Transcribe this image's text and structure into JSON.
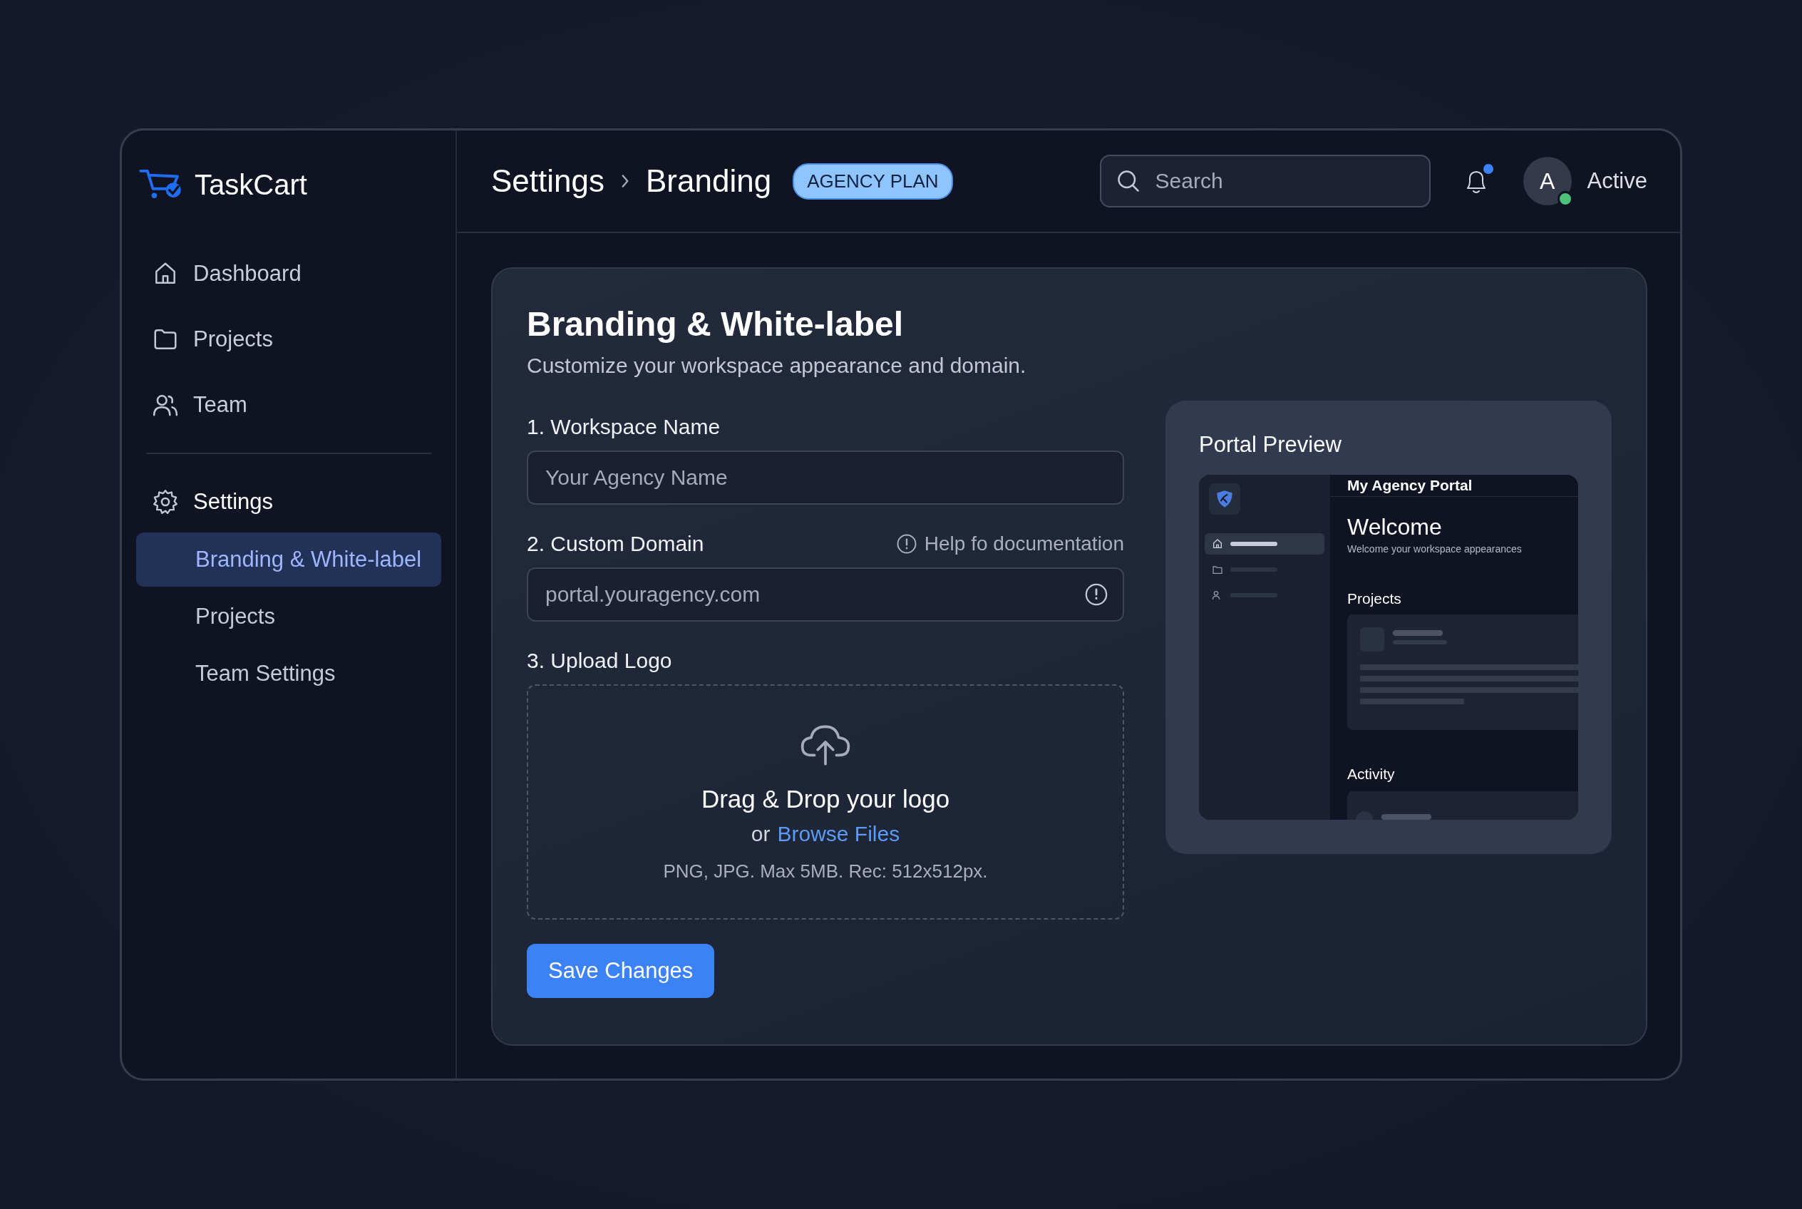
{
  "brand": "TaskCart",
  "nav": [
    {
      "label": "Dashboard",
      "selected": false
    },
    {
      "label": "Projects",
      "selected": false
    },
    {
      "label": "Team",
      "selected": false
    }
  ],
  "settings": {
    "label": "Settings",
    "items": [
      {
        "label": "Branding & White-label",
        "selected": true
      },
      {
        "label": "Projects",
        "selected": false
      },
      {
        "label": "Team Settings",
        "selected": false
      }
    ]
  },
  "header": {
    "breadcrumb": [
      "Settings",
      "Branding"
    ],
    "badge": "AGENCY PLAN",
    "search": {
      "placeholder": "Search"
    },
    "notifications_unread": true,
    "avatar": {
      "initial": "A",
      "online": true
    },
    "status": "Active"
  },
  "card": {
    "title": "Branding & White-label",
    "subtitle": "Customize your workspace appearance and domain.",
    "workspace_name": {
      "label": "1. Workspace Name",
      "placeholder": "Your Agency Name"
    },
    "custom_domain": {
      "label": "2. Custom Domain",
      "help": "Help fo documentation",
      "placeholder": "portal.youragency.com"
    },
    "upload": {
      "label": "3. Upload Logo",
      "title": "Drag & Drop your logo",
      "prefix": "or",
      "link": "Browse Files",
      "hint": "PNG, JPG. Max 5MB. Rec: 512x512px."
    },
    "save": "Save Changes"
  },
  "preview": {
    "title": "Portal Preview",
    "portal_title": "My Agency Portal",
    "welcome": "Welcome",
    "welcome_sub": "Welcome your workspace appearances",
    "nav": [
      {
        "selected": true
      },
      {
        "selected": false
      },
      {
        "selected": false
      }
    ],
    "sections": [
      {
        "title": "Projects",
        "kind": "card"
      },
      {
        "title": "Activity",
        "kind": "list"
      }
    ]
  }
}
